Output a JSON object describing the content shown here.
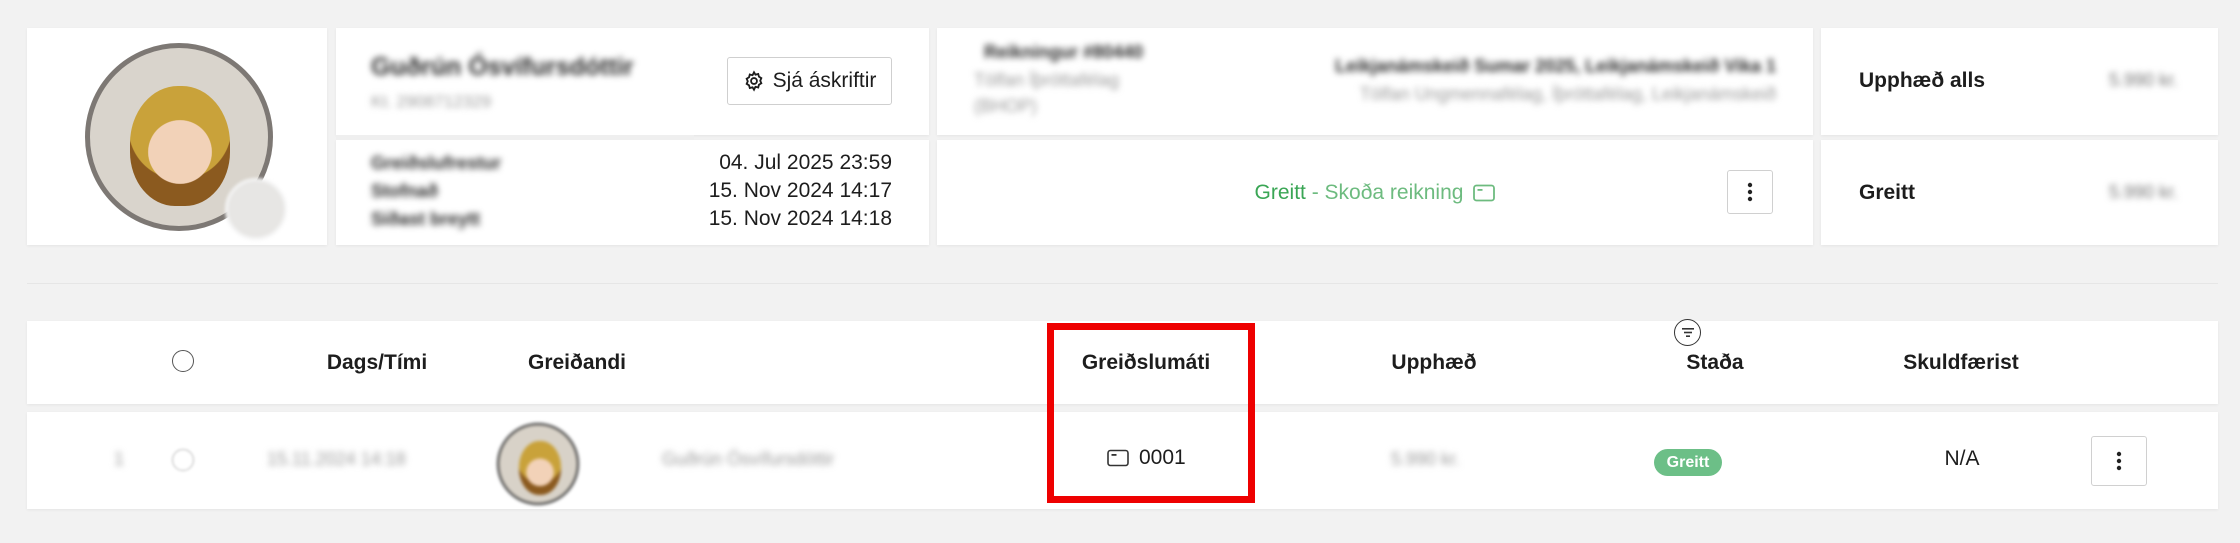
{
  "customer": {
    "name": "Guðrún Ósvífursdóttir",
    "kennitala": "Kt. 2908712329"
  },
  "subscriptions_button": {
    "label": "Sjá áskriftir",
    "icon": "gear-icon"
  },
  "meta": {
    "rows": [
      {
        "label": "Greiðslufrestur",
        "value": "04. Jul 2025 23:59"
      },
      {
        "label": "Stofnað",
        "value": "15. Nov 2024 14:17"
      },
      {
        "label": "Síðast breytt",
        "value": "15. Nov 2024 14:18"
      }
    ]
  },
  "invoice": {
    "number": "Reikningur #80440",
    "club": "Tölfan Íþróttafélag",
    "club_sub": "(BHOP)",
    "course": "Leikjanámskeið Sumar 2025, Leikjanámskeið Vika 1",
    "course_sub": "Tölfan Ungmennafélag, Íþróttafélag, Leikjanámskeið"
  },
  "status": {
    "paid_label": "Greitt",
    "view_invoice_label": " - Skoða reikning",
    "paid_color": "#3aa655",
    "link_color": "#6dbb7f"
  },
  "totals": {
    "total_label": "Upphæð alls",
    "total_value": "5.990 kr.",
    "paid_label": "Greitt",
    "paid_value": "5.990 kr."
  },
  "table": {
    "headers": {
      "date": "Dags/Tími",
      "payer": "Greiðandi",
      "method": "Greiðslumáti",
      "amount": "Upphæð",
      "status": "Staða",
      "charged": "Skuldfærist"
    },
    "rows": [
      {
        "index": "1",
        "date": "15.11.2024 14:18",
        "payer": "Guðrún Ósvífursdóttir",
        "method": "0001",
        "amount": "5.990 kr.",
        "status": "Greitt",
        "charged": "N/A"
      }
    ]
  },
  "highlight_color": "#ee0000"
}
